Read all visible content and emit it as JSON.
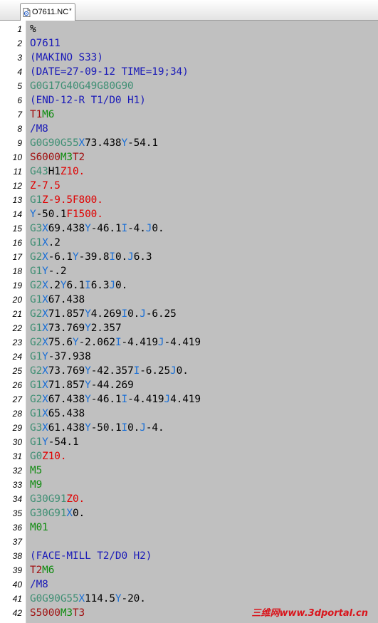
{
  "tab": {
    "title": "O7611.NC",
    "dirty_marker": "*"
  },
  "colors": {
    "gcode": "#3f8f74",
    "addr": "#1a6fd6",
    "mcode": "#0f8b0f",
    "red": "#e00000",
    "spindle": "#a01010",
    "text": "#000000",
    "comment": "#1a1ab8"
  },
  "lines": [
    {
      "num": "1",
      "tokens": [
        {
          "t": "%",
          "c": "text"
        }
      ]
    },
    {
      "num": "2",
      "tokens": [
        {
          "t": "O7611",
          "c": "comment"
        }
      ]
    },
    {
      "num": "3",
      "tokens": [
        {
          "t": "(MAKINO S33)",
          "c": "comment"
        }
      ]
    },
    {
      "num": "4",
      "tokens": [
        {
          "t": "(DATE=27-09-12 TIME=19;34)",
          "c": "comment"
        }
      ]
    },
    {
      "num": "5",
      "tokens": [
        {
          "t": "G0G17G40G49G80G90",
          "c": "gcode"
        }
      ]
    },
    {
      "num": "6",
      "tokens": [
        {
          "t": "(END-12-R T1/D0 H1)",
          "c": "comment"
        }
      ]
    },
    {
      "num": "7",
      "tokens": [
        {
          "t": "T1",
          "c": "spindle"
        },
        {
          "t": "M6",
          "c": "mcode"
        }
      ]
    },
    {
      "num": "8",
      "tokens": [
        {
          "t": "/M8",
          "c": "comment"
        }
      ]
    },
    {
      "num": "9",
      "tokens": [
        {
          "t": "G0G90G55",
          "c": "gcode"
        },
        {
          "t": "X",
          "c": "addr"
        },
        {
          "t": "73.438",
          "c": "text"
        },
        {
          "t": "Y",
          "c": "addr"
        },
        {
          "t": "-54.1",
          "c": "text"
        }
      ]
    },
    {
      "num": "10",
      "tokens": [
        {
          "t": "S6000",
          "c": "spindle"
        },
        {
          "t": "M3",
          "c": "mcode"
        },
        {
          "t": "T2",
          "c": "spindle"
        }
      ]
    },
    {
      "num": "11",
      "tokens": [
        {
          "t": "G43",
          "c": "gcode"
        },
        {
          "t": "H1",
          "c": "text"
        },
        {
          "t": "Z10.",
          "c": "red"
        }
      ]
    },
    {
      "num": "12",
      "tokens": [
        {
          "t": "Z-7.5",
          "c": "red"
        }
      ]
    },
    {
      "num": "13",
      "tokens": [
        {
          "t": "G1",
          "c": "gcode"
        },
        {
          "t": "Z-9.5",
          "c": "red"
        },
        {
          "t": "F800.",
          "c": "red"
        }
      ]
    },
    {
      "num": "14",
      "tokens": [
        {
          "t": "Y",
          "c": "addr"
        },
        {
          "t": "-50.1",
          "c": "text"
        },
        {
          "t": "F1500.",
          "c": "red"
        }
      ]
    },
    {
      "num": "15",
      "tokens": [
        {
          "t": "G3",
          "c": "gcode"
        },
        {
          "t": "X",
          "c": "addr"
        },
        {
          "t": "69.438",
          "c": "text"
        },
        {
          "t": "Y",
          "c": "addr"
        },
        {
          "t": "-46.1",
          "c": "text"
        },
        {
          "t": "I",
          "c": "addr"
        },
        {
          "t": "-4.",
          "c": "text"
        },
        {
          "t": "J",
          "c": "addr"
        },
        {
          "t": "0.",
          "c": "text"
        }
      ]
    },
    {
      "num": "16",
      "tokens": [
        {
          "t": "G1",
          "c": "gcode"
        },
        {
          "t": "X",
          "c": "addr"
        },
        {
          "t": ".2",
          "c": "text"
        }
      ]
    },
    {
      "num": "17",
      "tokens": [
        {
          "t": "G2",
          "c": "gcode"
        },
        {
          "t": "X",
          "c": "addr"
        },
        {
          "t": "-6.1",
          "c": "text"
        },
        {
          "t": "Y",
          "c": "addr"
        },
        {
          "t": "-39.8",
          "c": "text"
        },
        {
          "t": "I",
          "c": "addr"
        },
        {
          "t": "0.",
          "c": "text"
        },
        {
          "t": "J",
          "c": "addr"
        },
        {
          "t": "6.3",
          "c": "text"
        }
      ]
    },
    {
      "num": "18",
      "tokens": [
        {
          "t": "G1",
          "c": "gcode"
        },
        {
          "t": "Y",
          "c": "addr"
        },
        {
          "t": "-.2",
          "c": "text"
        }
      ]
    },
    {
      "num": "19",
      "tokens": [
        {
          "t": "G2",
          "c": "gcode"
        },
        {
          "t": "X",
          "c": "addr"
        },
        {
          "t": ".2",
          "c": "text"
        },
        {
          "t": "Y",
          "c": "addr"
        },
        {
          "t": "6.1",
          "c": "text"
        },
        {
          "t": "I",
          "c": "addr"
        },
        {
          "t": "6.3",
          "c": "text"
        },
        {
          "t": "J",
          "c": "addr"
        },
        {
          "t": "0.",
          "c": "text"
        }
      ]
    },
    {
      "num": "20",
      "tokens": [
        {
          "t": "G1",
          "c": "gcode"
        },
        {
          "t": "X",
          "c": "addr"
        },
        {
          "t": "67.438",
          "c": "text"
        }
      ]
    },
    {
      "num": "21",
      "tokens": [
        {
          "t": "G2",
          "c": "gcode"
        },
        {
          "t": "X",
          "c": "addr"
        },
        {
          "t": "71.857",
          "c": "text"
        },
        {
          "t": "Y",
          "c": "addr"
        },
        {
          "t": "4.269",
          "c": "text"
        },
        {
          "t": "I",
          "c": "addr"
        },
        {
          "t": "0.",
          "c": "text"
        },
        {
          "t": "J",
          "c": "addr"
        },
        {
          "t": "-6.25",
          "c": "text"
        }
      ]
    },
    {
      "num": "22",
      "tokens": [
        {
          "t": "G1",
          "c": "gcode"
        },
        {
          "t": "X",
          "c": "addr"
        },
        {
          "t": "73.769",
          "c": "text"
        },
        {
          "t": "Y",
          "c": "addr"
        },
        {
          "t": "2.357",
          "c": "text"
        }
      ]
    },
    {
      "num": "23",
      "tokens": [
        {
          "t": "G2",
          "c": "gcode"
        },
        {
          "t": "X",
          "c": "addr"
        },
        {
          "t": "75.6",
          "c": "text"
        },
        {
          "t": "Y",
          "c": "addr"
        },
        {
          "t": "-2.062",
          "c": "text"
        },
        {
          "t": "I",
          "c": "addr"
        },
        {
          "t": "-4.419",
          "c": "text"
        },
        {
          "t": "J",
          "c": "addr"
        },
        {
          "t": "-4.419",
          "c": "text"
        }
      ]
    },
    {
      "num": "24",
      "tokens": [
        {
          "t": "G1",
          "c": "gcode"
        },
        {
          "t": "Y",
          "c": "addr"
        },
        {
          "t": "-37.938",
          "c": "text"
        }
      ]
    },
    {
      "num": "25",
      "tokens": [
        {
          "t": "G2",
          "c": "gcode"
        },
        {
          "t": "X",
          "c": "addr"
        },
        {
          "t": "73.769",
          "c": "text"
        },
        {
          "t": "Y",
          "c": "addr"
        },
        {
          "t": "-42.357",
          "c": "text"
        },
        {
          "t": "I",
          "c": "addr"
        },
        {
          "t": "-6.25",
          "c": "text"
        },
        {
          "t": "J",
          "c": "addr"
        },
        {
          "t": "0.",
          "c": "text"
        }
      ]
    },
    {
      "num": "26",
      "tokens": [
        {
          "t": "G1",
          "c": "gcode"
        },
        {
          "t": "X",
          "c": "addr"
        },
        {
          "t": "71.857",
          "c": "text"
        },
        {
          "t": "Y",
          "c": "addr"
        },
        {
          "t": "-44.269",
          "c": "text"
        }
      ]
    },
    {
      "num": "27",
      "tokens": [
        {
          "t": "G2",
          "c": "gcode"
        },
        {
          "t": "X",
          "c": "addr"
        },
        {
          "t": "67.438",
          "c": "text"
        },
        {
          "t": "Y",
          "c": "addr"
        },
        {
          "t": "-46.1",
          "c": "text"
        },
        {
          "t": "I",
          "c": "addr"
        },
        {
          "t": "-4.419",
          "c": "text"
        },
        {
          "t": "J",
          "c": "addr"
        },
        {
          "t": "4.419",
          "c": "text"
        }
      ]
    },
    {
      "num": "28",
      "tokens": [
        {
          "t": "G1",
          "c": "gcode"
        },
        {
          "t": "X",
          "c": "addr"
        },
        {
          "t": "65.438",
          "c": "text"
        }
      ]
    },
    {
      "num": "29",
      "tokens": [
        {
          "t": "G3",
          "c": "gcode"
        },
        {
          "t": "X",
          "c": "addr"
        },
        {
          "t": "61.438",
          "c": "text"
        },
        {
          "t": "Y",
          "c": "addr"
        },
        {
          "t": "-50.1",
          "c": "text"
        },
        {
          "t": "I",
          "c": "addr"
        },
        {
          "t": "0.",
          "c": "text"
        },
        {
          "t": "J",
          "c": "addr"
        },
        {
          "t": "-4.",
          "c": "text"
        }
      ]
    },
    {
      "num": "30",
      "tokens": [
        {
          "t": "G1",
          "c": "gcode"
        },
        {
          "t": "Y",
          "c": "addr"
        },
        {
          "t": "-54.1",
          "c": "text"
        }
      ]
    },
    {
      "num": "31",
      "tokens": [
        {
          "t": "G0",
          "c": "gcode"
        },
        {
          "t": "Z10.",
          "c": "red"
        }
      ]
    },
    {
      "num": "32",
      "tokens": [
        {
          "t": "M5",
          "c": "mcode"
        }
      ]
    },
    {
      "num": "33",
      "tokens": [
        {
          "t": "M9",
          "c": "mcode"
        }
      ]
    },
    {
      "num": "34",
      "tokens": [
        {
          "t": "G30G91",
          "c": "gcode"
        },
        {
          "t": "Z0.",
          "c": "red"
        }
      ]
    },
    {
      "num": "35",
      "tokens": [
        {
          "t": "G30G91",
          "c": "gcode"
        },
        {
          "t": "X",
          "c": "addr"
        },
        {
          "t": "0.",
          "c": "text"
        }
      ]
    },
    {
      "num": "36",
      "tokens": [
        {
          "t": "M01",
          "c": "mcode"
        }
      ]
    },
    {
      "num": "37",
      "tokens": []
    },
    {
      "num": "38",
      "tokens": [
        {
          "t": "(FACE-MILL T2/D0 H2)",
          "c": "comment"
        }
      ]
    },
    {
      "num": "39",
      "tokens": [
        {
          "t": "T2",
          "c": "spindle"
        },
        {
          "t": "M6",
          "c": "mcode"
        }
      ]
    },
    {
      "num": "40",
      "tokens": [
        {
          "t": "/M8",
          "c": "comment"
        }
      ]
    },
    {
      "num": "41",
      "tokens": [
        {
          "t": "G0G90G55",
          "c": "gcode"
        },
        {
          "t": "X",
          "c": "addr"
        },
        {
          "t": "114.5",
          "c": "text"
        },
        {
          "t": "Y",
          "c": "addr"
        },
        {
          "t": "-20.",
          "c": "text"
        }
      ]
    },
    {
      "num": "42",
      "tokens": [
        {
          "t": "S5000",
          "c": "spindle"
        },
        {
          "t": "M3",
          "c": "mcode"
        },
        {
          "t": "T3",
          "c": "spindle"
        }
      ]
    }
  ],
  "watermark": "三维网www.3dportal.cn"
}
